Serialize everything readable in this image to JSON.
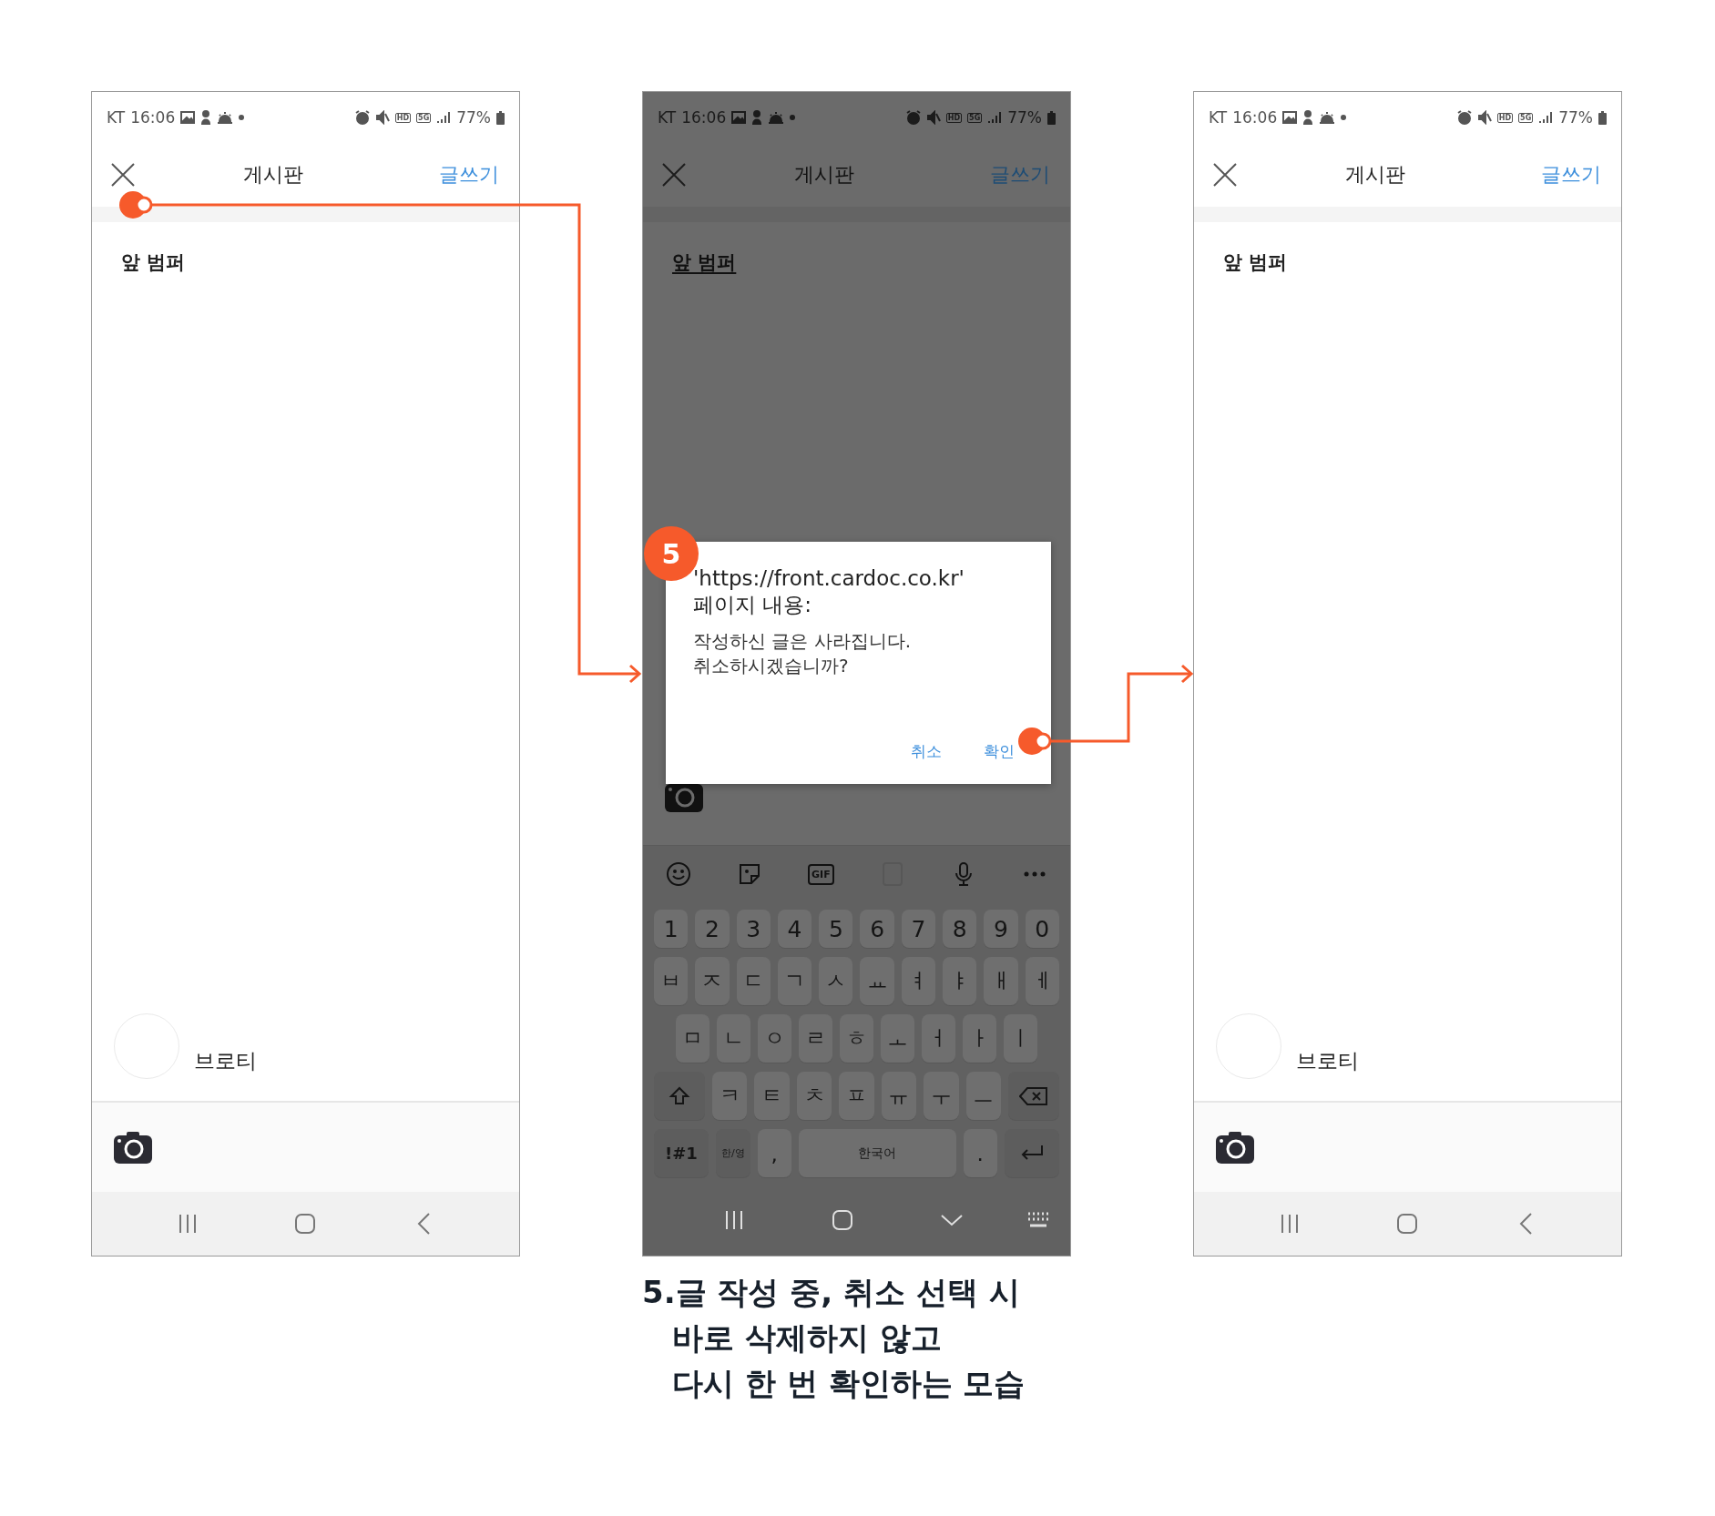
{
  "phones": [
    {
      "kind": "editor",
      "dimmed": false,
      "composing": false,
      "status_bar": {
        "carrier": "KT",
        "time": "16:06",
        "hd": "HD",
        "network": "5G",
        "battery": "77%"
      },
      "header": {
        "title": "게시판",
        "action": "글쓰기"
      },
      "post_title": "앞 범퍼",
      "author": {
        "name": "브로티"
      }
    },
    {
      "kind": "confirm",
      "dimmed": true,
      "composing": true,
      "status_bar": {
        "carrier": "KT",
        "time": "16:06",
        "hd": "HD",
        "network": "5G",
        "battery": "77%"
      },
      "header": {
        "title": "게시판",
        "action": "글쓰기"
      },
      "post_title": "앞 범퍼",
      "keyboard": {
        "gif": "GIF",
        "rows": [
          [
            {
              "kind": "char",
              "label": "1"
            },
            {
              "kind": "char",
              "label": "2"
            },
            {
              "kind": "char",
              "label": "3"
            },
            {
              "kind": "char",
              "label": "4"
            },
            {
              "kind": "char",
              "label": "5"
            },
            {
              "kind": "char",
              "label": "6"
            },
            {
              "kind": "char",
              "label": "7"
            },
            {
              "kind": "char",
              "label": "8"
            },
            {
              "kind": "char",
              "label": "9"
            },
            {
              "kind": "char",
              "label": "0"
            }
          ],
          [
            {
              "kind": "char",
              "label": "ㅂ"
            },
            {
              "kind": "char",
              "label": "ㅈ"
            },
            {
              "kind": "char",
              "label": "ㄷ"
            },
            {
              "kind": "char",
              "label": "ㄱ"
            },
            {
              "kind": "char",
              "label": "ㅅ"
            },
            {
              "kind": "char",
              "label": "ㅛ"
            },
            {
              "kind": "char",
              "label": "ㅕ"
            },
            {
              "kind": "char",
              "label": "ㅑ"
            },
            {
              "kind": "char",
              "label": "ㅐ"
            },
            {
              "kind": "char",
              "label": "ㅔ"
            }
          ],
          [
            {
              "kind": "char",
              "label": "ㅁ"
            },
            {
              "kind": "char",
              "label": "ㄴ"
            },
            {
              "kind": "char",
              "label": "ㅇ"
            },
            {
              "kind": "char",
              "label": "ㄹ"
            },
            {
              "kind": "char",
              "label": "ㅎ"
            },
            {
              "kind": "char",
              "label": "ㅗ"
            },
            {
              "kind": "char",
              "label": "ㅓ"
            },
            {
              "kind": "char",
              "label": "ㅏ"
            },
            {
              "kind": "char",
              "label": "ㅣ"
            }
          ],
          [
            {
              "kind": "shift"
            },
            {
              "kind": "char",
              "label": "ㅋ"
            },
            {
              "kind": "char",
              "label": "ㅌ"
            },
            {
              "kind": "char",
              "label": "ㅊ"
            },
            {
              "kind": "char",
              "label": "ㅍ"
            },
            {
              "kind": "char",
              "label": "ㅠ"
            },
            {
              "kind": "char",
              "label": "ㅜ"
            },
            {
              "kind": "char",
              "label": "ㅡ"
            },
            {
              "kind": "backspace"
            }
          ],
          [
            {
              "kind": "function",
              "label": "!#1"
            },
            {
              "kind": "lang",
              "label": "한/영"
            },
            {
              "kind": "char",
              "label": ","
            },
            {
              "kind": "space",
              "label": "한국어"
            },
            {
              "kind": "char",
              "label": "."
            },
            {
              "kind": "enter"
            }
          ]
        ]
      },
      "dialog": {
        "origin": "'https://front.cardoc.co.kr'",
        "heading": "페이지 내용:",
        "message": [
          "작성하신 글은 사라집니다.",
          "취소하시겠습니까?"
        ],
        "buttons": [
          "취소",
          "확인"
        ]
      }
    },
    {
      "kind": "editor",
      "dimmed": false,
      "composing": false,
      "status_bar": {
        "carrier": "KT",
        "time": "16:06",
        "hd": "HD",
        "network": "5G",
        "battery": "77%"
      },
      "header": {
        "title": "게시판",
        "action": "글쓰기"
      },
      "post_title": "앞 범퍼",
      "author": {
        "name": "브로티"
      }
    }
  ],
  "step_badge": "5",
  "caption": [
    "5.글 작성 중, 취소 선택 시",
    "바로 삭제하지 않고",
    "다시 한 번 확인하는 모습"
  ]
}
